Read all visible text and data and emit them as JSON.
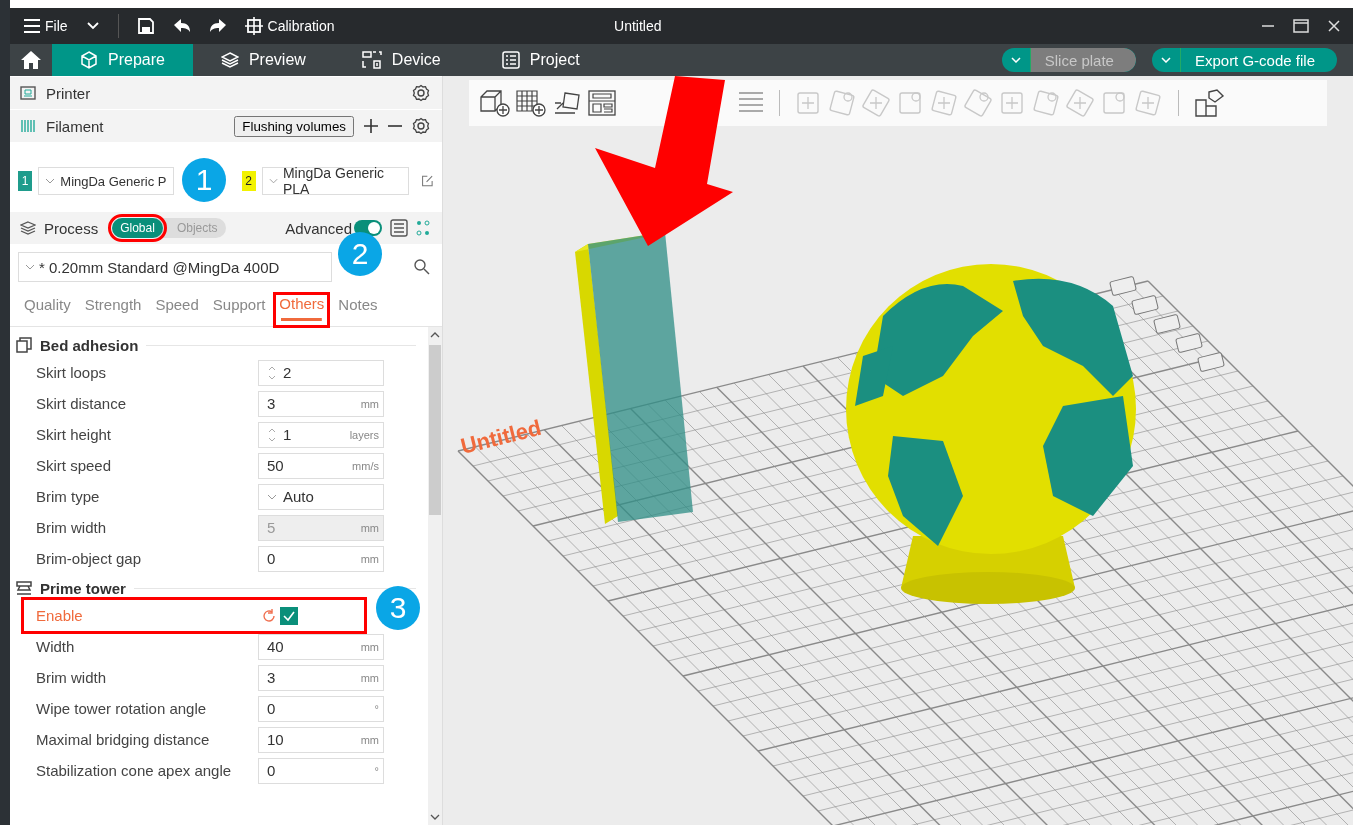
{
  "title_bar": {
    "menu": "File",
    "calibration": "Calibration",
    "title": "Untitled"
  },
  "nav_tabs": [
    {
      "label": "Prepare",
      "selected": true
    },
    {
      "label": "Preview",
      "selected": false
    },
    {
      "label": "Device",
      "selected": false
    },
    {
      "label": "Project",
      "selected": false
    }
  ],
  "slice_button": {
    "label": "Slice plate",
    "disabled": true
  },
  "export_button": {
    "label": "Export G-code file",
    "disabled": false
  },
  "printer": {
    "label": "Printer"
  },
  "filament": {
    "label": "Filament",
    "flushing": "Flushing volumes",
    "slots": [
      {
        "number": "1",
        "color": "#1f9c8c",
        "name": "MingDa Generic P"
      },
      {
        "number": "2",
        "color": "#f2f200",
        "name": "MingDa Generic PLA"
      }
    ]
  },
  "process": {
    "label": "Process",
    "scope": [
      {
        "label": "Global",
        "selected": true,
        "marker": "1"
      },
      {
        "label": "Objects",
        "selected": false
      }
    ],
    "advanced": {
      "label": "Advanced",
      "on": true
    },
    "preset": "* 0.20mm Standard @MingDa 400D",
    "tabs": [
      {
        "label": "Quality",
        "selected": false
      },
      {
        "label": "Strength",
        "selected": false
      },
      {
        "label": "Speed",
        "selected": false
      },
      {
        "label": "Support",
        "selected": false
      },
      {
        "label": "Others",
        "selected": true,
        "marker": "2"
      },
      {
        "label": "Notes",
        "selected": false
      }
    ]
  },
  "sections": [
    {
      "title": "Bed adhesion",
      "rows": [
        {
          "kind": "spin",
          "label": "Skirt loops",
          "value": "2",
          "disabled": false,
          "modified": false
        },
        {
          "kind": "number",
          "label": "Skirt distance",
          "value": "3",
          "unit": "mm",
          "disabled": false,
          "modified": false
        },
        {
          "kind": "spin",
          "label": "Skirt height",
          "value": "1",
          "unit": "layers",
          "disabled": false,
          "modified": false
        },
        {
          "kind": "number",
          "label": "Skirt speed",
          "value": "50",
          "unit": "mm/s",
          "disabled": false,
          "modified": false
        },
        {
          "kind": "select",
          "label": "Brim type",
          "value": "Auto",
          "disabled": false,
          "modified": false
        },
        {
          "kind": "number",
          "label": "Brim width",
          "value": "5",
          "unit": "mm",
          "disabled": true,
          "modified": false
        },
        {
          "kind": "number",
          "label": "Brim-object gap",
          "value": "0",
          "unit": "mm",
          "disabled": false,
          "modified": false
        }
      ]
    },
    {
      "title": "Prime tower",
      "rows": [
        {
          "kind": "checkbox",
          "label": "Enable",
          "checked": true,
          "modified": true,
          "marker": "3"
        },
        {
          "kind": "number",
          "label": "Width",
          "value": "40",
          "unit": "mm",
          "disabled": false,
          "modified": false
        },
        {
          "kind": "number",
          "label": "Brim width",
          "value": "3",
          "unit": "mm",
          "disabled": false,
          "modified": false
        },
        {
          "kind": "number",
          "label": "Wipe tower rotation angle",
          "value": "0",
          "unit": "°",
          "disabled": false,
          "modified": false
        },
        {
          "kind": "number",
          "label": "Maximal bridging distance",
          "value": "10",
          "unit": "mm",
          "disabled": false,
          "modified": false
        },
        {
          "kind": "number",
          "label": "Stabilization cone apex angle",
          "value": "0",
          "unit": "°",
          "disabled": false,
          "modified": false
        }
      ]
    }
  ],
  "plate": {
    "label": "Untitled"
  },
  "annotations": {
    "arrow": true
  }
}
